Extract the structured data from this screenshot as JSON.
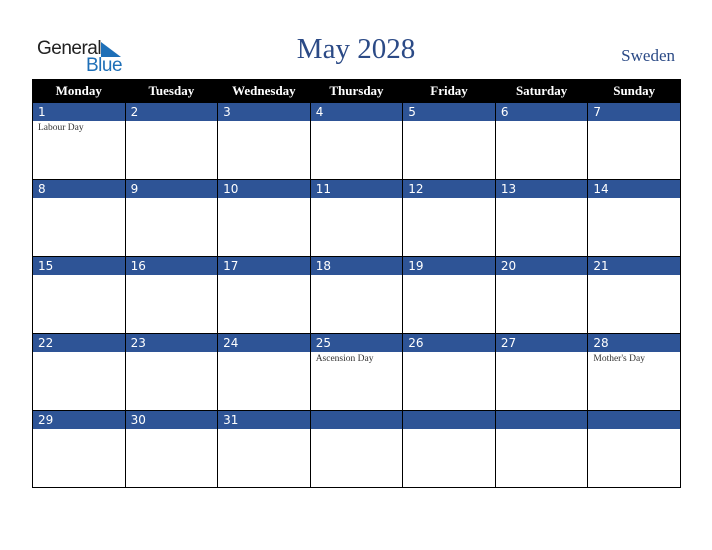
{
  "logo": {
    "general": "General",
    "blue": "Blue"
  },
  "title": "May 2028",
  "country": "Sweden",
  "weekdays": [
    "Monday",
    "Tuesday",
    "Wednesday",
    "Thursday",
    "Friday",
    "Saturday",
    "Sunday"
  ],
  "weeks": [
    [
      {
        "day": "1",
        "event": "Labour Day"
      },
      {
        "day": "2",
        "event": ""
      },
      {
        "day": "3",
        "event": ""
      },
      {
        "day": "4",
        "event": ""
      },
      {
        "day": "5",
        "event": ""
      },
      {
        "day": "6",
        "event": ""
      },
      {
        "day": "7",
        "event": ""
      }
    ],
    [
      {
        "day": "8",
        "event": ""
      },
      {
        "day": "9",
        "event": ""
      },
      {
        "day": "10",
        "event": ""
      },
      {
        "day": "11",
        "event": ""
      },
      {
        "day": "12",
        "event": ""
      },
      {
        "day": "13",
        "event": ""
      },
      {
        "day": "14",
        "event": ""
      }
    ],
    [
      {
        "day": "15",
        "event": ""
      },
      {
        "day": "16",
        "event": ""
      },
      {
        "day": "17",
        "event": ""
      },
      {
        "day": "18",
        "event": ""
      },
      {
        "day": "19",
        "event": ""
      },
      {
        "day": "20",
        "event": ""
      },
      {
        "day": "21",
        "event": ""
      }
    ],
    [
      {
        "day": "22",
        "event": ""
      },
      {
        "day": "23",
        "event": ""
      },
      {
        "day": "24",
        "event": ""
      },
      {
        "day": "25",
        "event": "Ascension Day"
      },
      {
        "day": "26",
        "event": ""
      },
      {
        "day": "27",
        "event": ""
      },
      {
        "day": "28",
        "event": "Mother's Day"
      }
    ],
    [
      {
        "day": "29",
        "event": ""
      },
      {
        "day": "30",
        "event": ""
      },
      {
        "day": "31",
        "event": ""
      },
      {
        "day": "",
        "event": ""
      },
      {
        "day": "",
        "event": ""
      },
      {
        "day": "",
        "event": ""
      },
      {
        "day": "",
        "event": ""
      }
    ]
  ]
}
